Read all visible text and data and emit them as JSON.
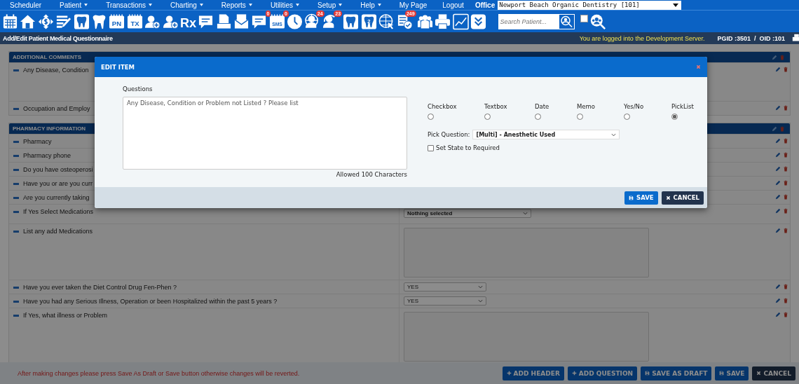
{
  "menu": [
    {
      "label": "Scheduler",
      "has_menu": false
    },
    {
      "label": "Patient",
      "has_menu": true
    },
    {
      "label": "Transactions",
      "has_menu": true
    },
    {
      "label": "Charting",
      "has_menu": true
    },
    {
      "label": "Reports",
      "has_menu": true
    },
    {
      "label": "Utilities",
      "has_menu": true
    },
    {
      "label": "Setup",
      "has_menu": true
    },
    {
      "label": "Help",
      "has_menu": true
    },
    {
      "label": "My Page",
      "has_menu": false
    },
    {
      "label": "Logout",
      "has_menu": false
    }
  ],
  "office": {
    "label": "Office",
    "value": "Newport Beach Organic Dentistry [101]"
  },
  "toolbar": [
    {
      "kind": "calendar"
    },
    {
      "kind": "home"
    },
    {
      "kind": "dollar"
    },
    {
      "kind": "edit-list"
    },
    {
      "kind": "tooth-chart"
    },
    {
      "kind": "tooth-roots"
    },
    {
      "kind": "text",
      "label": "PN"
    },
    {
      "kind": "text",
      "label": "TX"
    },
    {
      "kind": "user-plus"
    },
    {
      "kind": "user-plus"
    },
    {
      "kind": "rx",
      "label": "Rx"
    },
    {
      "kind": "note"
    },
    {
      "kind": "scanner"
    },
    {
      "kind": "envelope"
    },
    {
      "kind": "chat",
      "badge": "0"
    },
    {
      "kind": "sms",
      "label": "SMS",
      "badge": "0"
    },
    {
      "kind": "clock"
    },
    {
      "kind": "globe-user",
      "badge": "24"
    },
    {
      "kind": "refresh-user",
      "badge": "23"
    },
    {
      "kind": "tooth"
    },
    {
      "kind": "tooth-number",
      "label": "2"
    },
    {
      "kind": "globe-cursor"
    },
    {
      "kind": "list-check",
      "badge": "249"
    },
    {
      "kind": "group"
    },
    {
      "kind": "printer"
    },
    {
      "kind": "chart"
    },
    {
      "kind": "chevrons"
    }
  ],
  "search": {
    "placeholder": "Search Patient...",
    "include_checked": false
  },
  "page_title": "Add/Edit Patient Medical Questionnaire",
  "server_notice": "You are logged into the Development Server.",
  "ids": {
    "pgid": "PGID :3501",
    "separator": "/",
    "oid": "OID :101"
  },
  "sections": [
    {
      "title": "ADDITIONAL COMMENTS",
      "rows": [
        {
          "question": "Any Disease, Condition",
          "kind": "memo-hidden"
        },
        {
          "question": "Occupation and Employ",
          "kind": "hidden"
        }
      ]
    },
    {
      "title": "PHARMACY INFORMATION",
      "rows": [
        {
          "question": "Pharmacy",
          "kind": "hidden"
        },
        {
          "question": "Pharmacy phone",
          "kind": "hidden"
        },
        {
          "question": "Do you have osteoperosi",
          "kind": "hidden"
        },
        {
          "question": "Have you or are you curr",
          "kind": "hidden"
        },
        {
          "question": "Are you currently taking",
          "kind": "hidden"
        },
        {
          "question": "If Yes Select Medications",
          "kind": "select",
          "value": "Nothing selected"
        },
        {
          "question": "List any add Medications",
          "kind": "memo"
        },
        {
          "question": "Have you ever taken the Diet Control Drug Fen-Phen ?",
          "kind": "select-small",
          "value": "YES"
        },
        {
          "question": "Have you had any Serious Illness, Operation or been Hospitalized within the past 5 years ?",
          "kind": "select-small",
          "value": "YES"
        },
        {
          "question": "If Yes, what illness or Problem",
          "kind": "memo"
        }
      ]
    }
  ],
  "footer": {
    "message": "After making changes please press Save As Draft or Save button otherwise changes will be reverted.",
    "buttons": [
      {
        "label": "ADD HEADER",
        "kind": "plus"
      },
      {
        "label": "ADD QUESTION",
        "kind": "plus"
      },
      {
        "label": "SAVE AS DRAFT",
        "kind": "save"
      },
      {
        "label": "SAVE",
        "kind": "save"
      },
      {
        "label": "CANCEL",
        "kind": "cancel"
      }
    ]
  },
  "dialog": {
    "title": "EDIT ITEM",
    "questions_label": "Questions",
    "question": "Any Disease, Condition or Problem not Listed ? Please list",
    "allowed": "Allowed 100 Characters",
    "types": [
      {
        "label": "Checkbox",
        "selected": false
      },
      {
        "label": "Textbox",
        "selected": false
      },
      {
        "label": "Date",
        "selected": false
      },
      {
        "label": "Memo",
        "selected": false
      },
      {
        "label": "Yes/No",
        "selected": false
      },
      {
        "label": "PickList",
        "selected": true
      }
    ],
    "pick_label": "Pick Question:",
    "pick_value": "[Multi] - Anesthetic Used",
    "required_label": "Set State to Required",
    "required": false,
    "buttons": [
      {
        "label": "SAVE",
        "kind": "save"
      },
      {
        "label": "CANCEL",
        "kind": "cancel"
      }
    ]
  }
}
